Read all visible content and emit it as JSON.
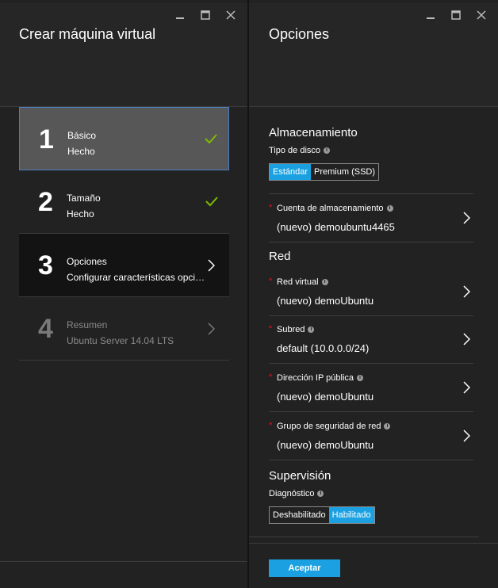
{
  "left_blade": {
    "title": "Crear máquina virtual",
    "steps": [
      {
        "number": "1",
        "title": "Básico",
        "subtitle": "Hecho"
      },
      {
        "number": "2",
        "title": "Tamaño",
        "subtitle": "Hecho"
      },
      {
        "number": "3",
        "title": "Opciones",
        "subtitle": "Configurar características opcio..."
      },
      {
        "number": "4",
        "title": "Resumen",
        "subtitle": "Ubuntu Server 14.04 LTS"
      }
    ]
  },
  "right_blade": {
    "title": "Opciones",
    "storage": {
      "heading": "Almacenamiento",
      "disk_type_label": "Tipo de disco",
      "disk_options": [
        "Estándar",
        "Premium (SSD)"
      ],
      "disk_selected": "Estándar",
      "account_label": "Cuenta de almacenamiento",
      "account_value": "(nuevo) demoubuntu4465"
    },
    "network": {
      "heading": "Red",
      "vnet_label": "Red virtual",
      "vnet_value": "(nuevo) demoUbuntu",
      "subnet_label": "Subred",
      "subnet_value": "default (10.0.0.0/24)",
      "pip_label": "Dirección IP pública",
      "pip_value": "(nuevo) demoUbuntu",
      "nsg_label": "Grupo de seguridad de red",
      "nsg_value": "(nuevo) demoUbuntu"
    },
    "monitoring": {
      "heading": "Supervisión",
      "diag_label": "Diagnóstico",
      "diag_options": [
        "Deshabilitado",
        "Habilitado"
      ],
      "diag_selected": "Habilitado"
    },
    "accept_label": "Aceptar"
  },
  "colors": {
    "accent": "#1ba1e2",
    "check": "#7fba00",
    "required": "#e81123",
    "selected_border": "#4a7ec4"
  },
  "icons": {
    "minimize": "minimize-icon",
    "maximize": "maximize-icon",
    "close": "close-icon",
    "check": "checkmark-icon",
    "chevron": "chevron-right-icon",
    "info": "info-icon"
  }
}
